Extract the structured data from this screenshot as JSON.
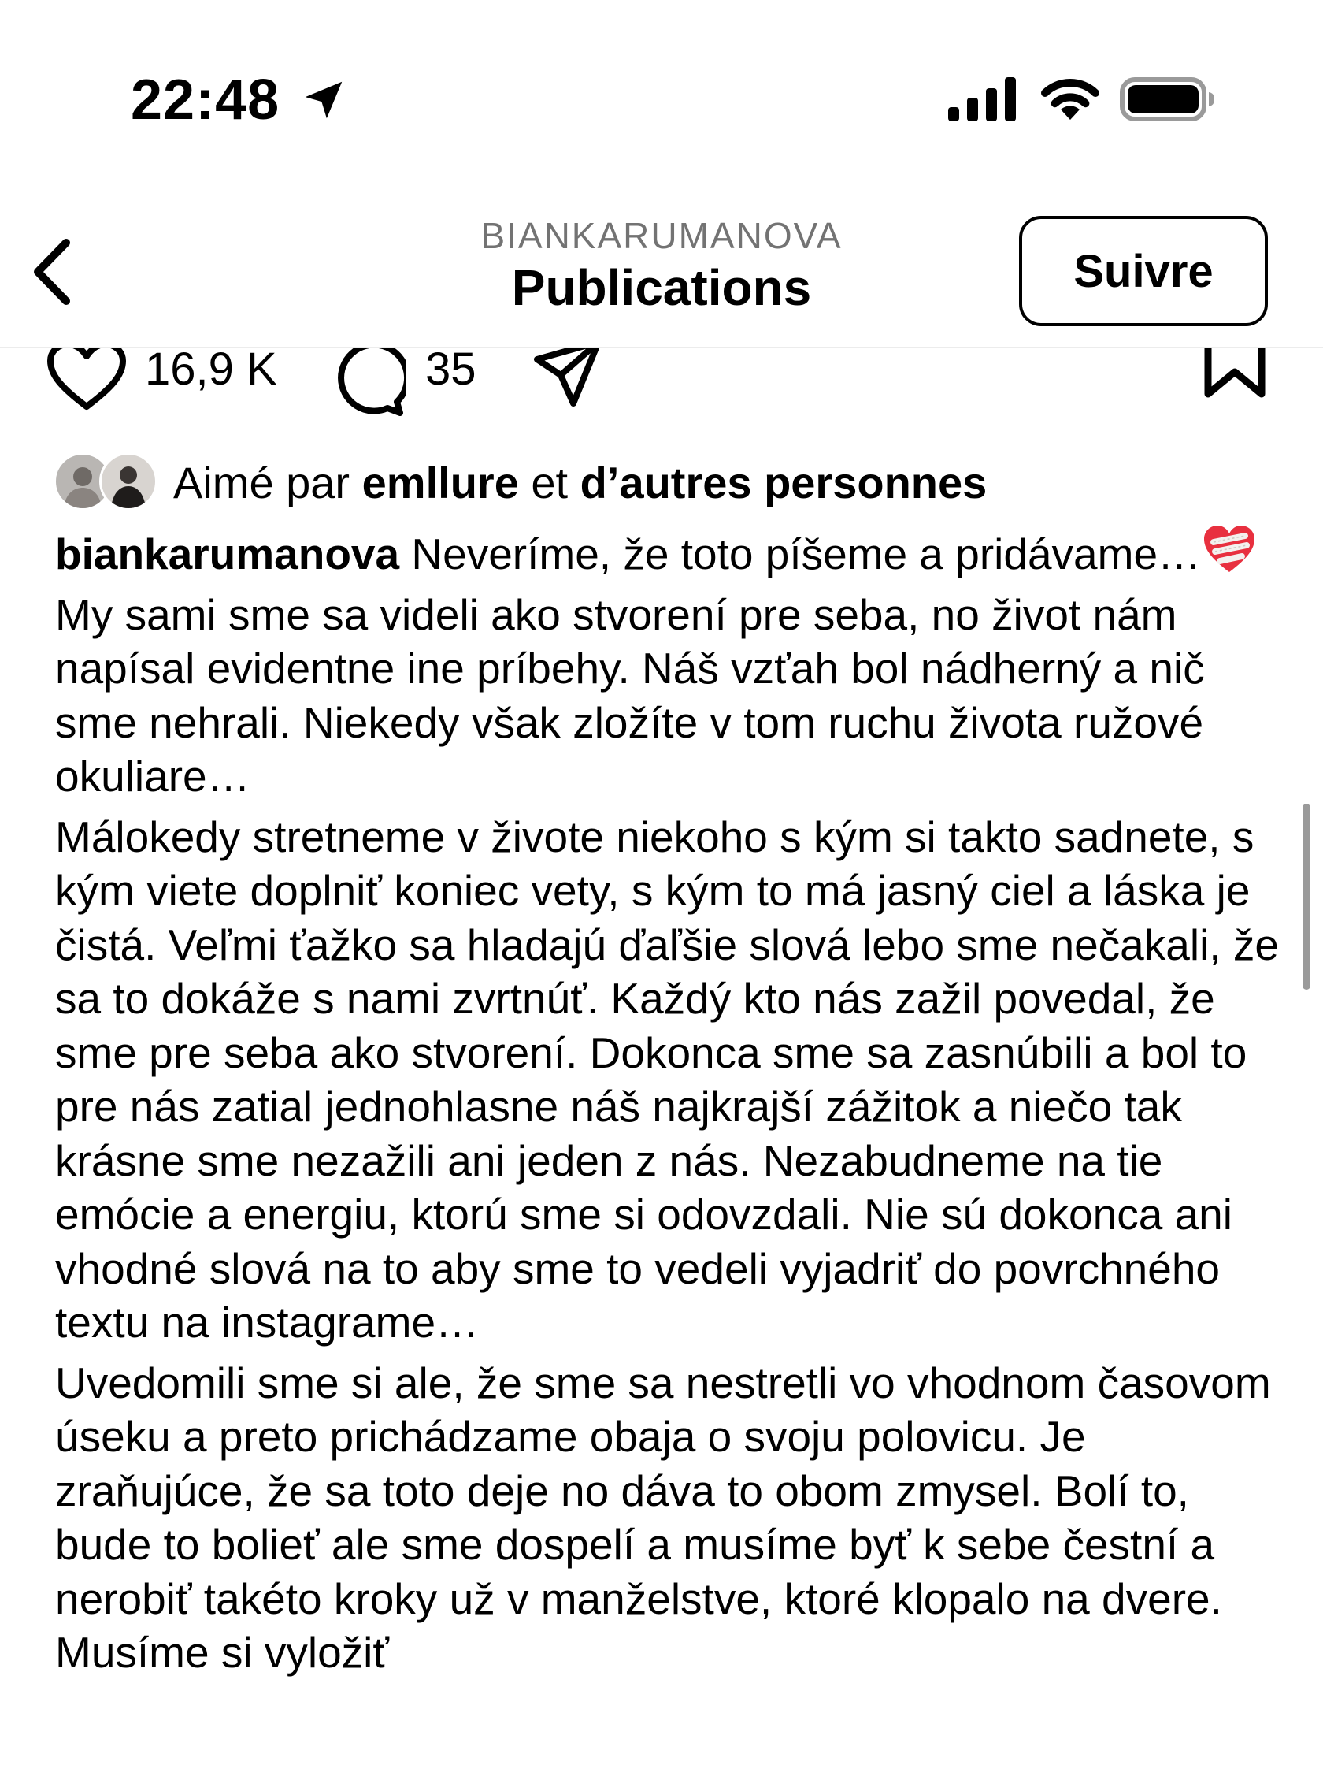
{
  "status_bar": {
    "time": "22:48",
    "icons": [
      "location-arrow-icon",
      "cellular-signal-icon",
      "wifi-icon",
      "battery-icon"
    ]
  },
  "header": {
    "username": "BIANKARUMANOVA",
    "title": "Publications",
    "follow_label": "Suivre",
    "back_icon": "chevron-left-icon"
  },
  "actions": {
    "likes": "16,9 K",
    "comments": "35",
    "icons": [
      "heart-icon",
      "comment-icon",
      "share-icon",
      "bookmark-icon"
    ]
  },
  "liked_by": {
    "prefix": "Aimé par ",
    "user": "emllure",
    "middle": " et ",
    "others": "d’autres personnes"
  },
  "caption": {
    "author": "biankarumanova",
    "intro": " Neveríme, že toto píšeme a pridávame…",
    "emoji": "mending-heart-emoji",
    "paragraphs": [
      "My sami sme sa videli ako stvorení pre seba, no život nám napísal evidentne ine príbehy. Náš vzťah bol nádherný a nič sme nehrali. Niekedy však zložíte v tom ruchu života ružové okuliare…",
      "Málokedy stretneme v živote niekoho s kým si takto sadnete, s kým viete doplniť koniec vety, s kým to má jasný ciel a láska je čistá. Veľmi ťažko sa hladajú ďaľšie slová lebo sme nečakali, že sa to dokáže s nami zvrtnúť. Každý kto nás zažil povedal, že sme pre seba ako stvorení. Dokonca sme sa zasnúbili a bol to pre nás zatial jednohlasne náš najkrajší zážitok a niečo tak krásne sme nezažili ani jeden z nás. Nezabudneme na tie emócie a energiu, ktorú sme si odovzdali. Nie sú dokonca ani vhodné slová na to aby sme to vedeli vyjadriť do povrchného textu na instagrame…",
      "Uvedomili sme si ale, že sme sa nestretli vo vhodnom časovom úseku a preto prichádzame obaja o svoju polovicu. Je zraňujúce, že sa toto deje no dáva to obom zmysel. Bolí to, bude to bolieť ale sme dospelí a musíme byť k sebe čestní a nerobiť takéto kroky už v manželstve, ktoré klopalo na dvere. Musíme si vyložiť"
    ]
  }
}
